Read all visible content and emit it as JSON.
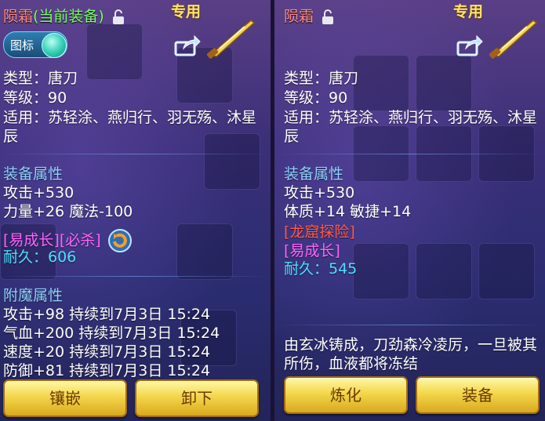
{
  "left": {
    "name": "陨霜",
    "equipped_tag": "(当前装备)",
    "exclusive": "专用",
    "toggle_label": "图标",
    "type_line": "类型：唐刀",
    "level_line": "等级：90",
    "suits_line": "适用：苏轻涂、燕归行、羽无殇、沐星辰",
    "attr_title": "装备属性",
    "attr_1": "攻击+530",
    "attr_2": "力量+26 魔法-100",
    "tags": "[易成长][必杀]",
    "durability": "耐久：606",
    "enchant_title": "附魔属性",
    "enchant_1": "攻击+98 持续到7月3日 15:24",
    "enchant_2": "气血+200 持续到7月3日 15:24",
    "enchant_3": "速度+20 持续到7月3日 15:24",
    "enchant_4": "防御+81 持续到7月3日 15:24",
    "btn_inlay": "镶嵌",
    "btn_unequip": "卸下"
  },
  "right": {
    "name": "陨霜",
    "exclusive": "专用",
    "type_line": "类型：唐刀",
    "level_line": "等级：90",
    "suits_line": "适用：苏轻涂、燕归行、羽无殇、沐星辰",
    "attr_title": "装备属性",
    "attr_1": "攻击+530",
    "attr_2": "体质+14 敏捷+14",
    "tag_dragon": "[龙窟探险]",
    "tag_growth": "[易成长]",
    "durability": "耐久：545",
    "description": "由玄冰铸成，刀劲森冷凌厉，一旦被其所伤，血液都将冻结",
    "btn_refine": "炼化",
    "btn_equip": "装备"
  },
  "colors": {
    "name": "#ff8a8a",
    "equipped": "#7cff6a",
    "exclusive": "#ffe36a",
    "section": "#8fd0ff",
    "tag_magenta": "#ff66ff",
    "tag_red": "#ff5a4a",
    "durability": "#4fe0ff",
    "button": "#f3d64a"
  },
  "icons": {
    "lock": "lock-open-icon",
    "share": "share-icon",
    "weapon": "blade-weapon-icon",
    "refresh": "refresh-icon"
  }
}
